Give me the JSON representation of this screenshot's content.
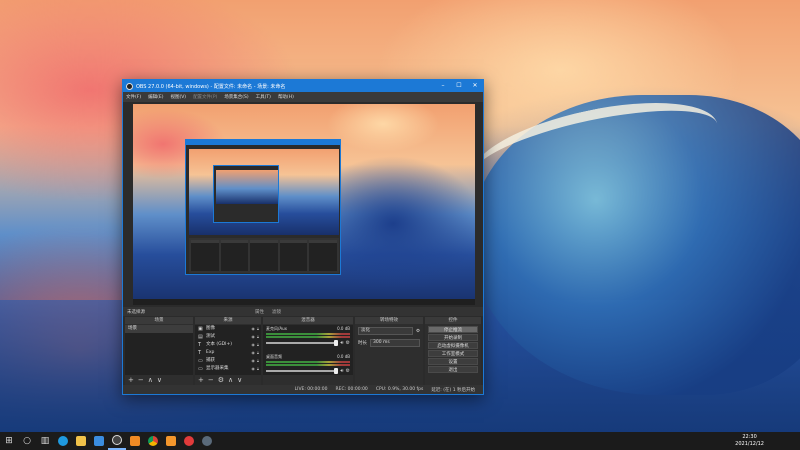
{
  "obs": {
    "title": "OBS 27.0.0 (64-bit, windows) - 配置文件: 未命名 - 场景: 未命名",
    "menu": [
      "文件(F)",
      "编辑(E)",
      "视图(V)",
      "配置文件(P)",
      "场景集合(S)",
      "工具(T)",
      "帮助(H)"
    ],
    "control_left": "未选择源",
    "control_mid": [
      "属性",
      "滤镜"
    ],
    "docks": {
      "scenes": {
        "title": "场景",
        "items": [
          "场景"
        ]
      },
      "sources": {
        "title": "来源",
        "items": [
          {
            "icon": "image-icon",
            "glyph": "▣",
            "label": "图像"
          },
          {
            "icon": "browser-icon",
            "glyph": "▤",
            "label": "测试"
          },
          {
            "icon": "text-icon",
            "glyph": "T",
            "label": "文本 (GDI+)"
          },
          {
            "icon": "text-icon",
            "glyph": "T",
            "label": "Exp"
          },
          {
            "icon": "display-icon",
            "glyph": "▭",
            "label": "捕获"
          },
          {
            "icon": "display-icon",
            "glyph": "▭",
            "label": "显示器采集"
          }
        ]
      },
      "mixer": {
        "title": "混音器",
        "channels": [
          {
            "name": "麦克风/Aux",
            "db": "0.0 dB"
          },
          {
            "name": "桌面音频",
            "db": "0.0 dB"
          }
        ]
      },
      "transitions": {
        "title": "转场特效",
        "type": "淡化",
        "duration_label": "时长",
        "duration": "300 ms"
      },
      "controls": {
        "title": "控件",
        "buttons": [
          "停止推流",
          "开始录制",
          "启动虚拟摄像机",
          "工作室模式",
          "设置",
          "退出"
        ]
      }
    },
    "status": {
      "live": "LIVE: 00:00:00",
      "rec": "REC: 00:00:00",
      "cpu": "CPU: 0.9%, 30.00 fps",
      "stream": "延迟: (在) 1 秒后开始"
    }
  },
  "taskbar": {
    "items": [
      "windows-start-icon",
      "search-icon",
      "task-view-icon",
      "edge-icon",
      "explorer-icon",
      "store-icon",
      "obs-icon",
      "app-orange-icon",
      "chrome-icon",
      "app-orange2-icon",
      "app-red-icon",
      "app-obs2-icon"
    ],
    "time": "22:30",
    "date": "2021/12/12"
  },
  "colors": {
    "accent": "#1c79d6",
    "obs_bg": "#2b2b2b"
  }
}
